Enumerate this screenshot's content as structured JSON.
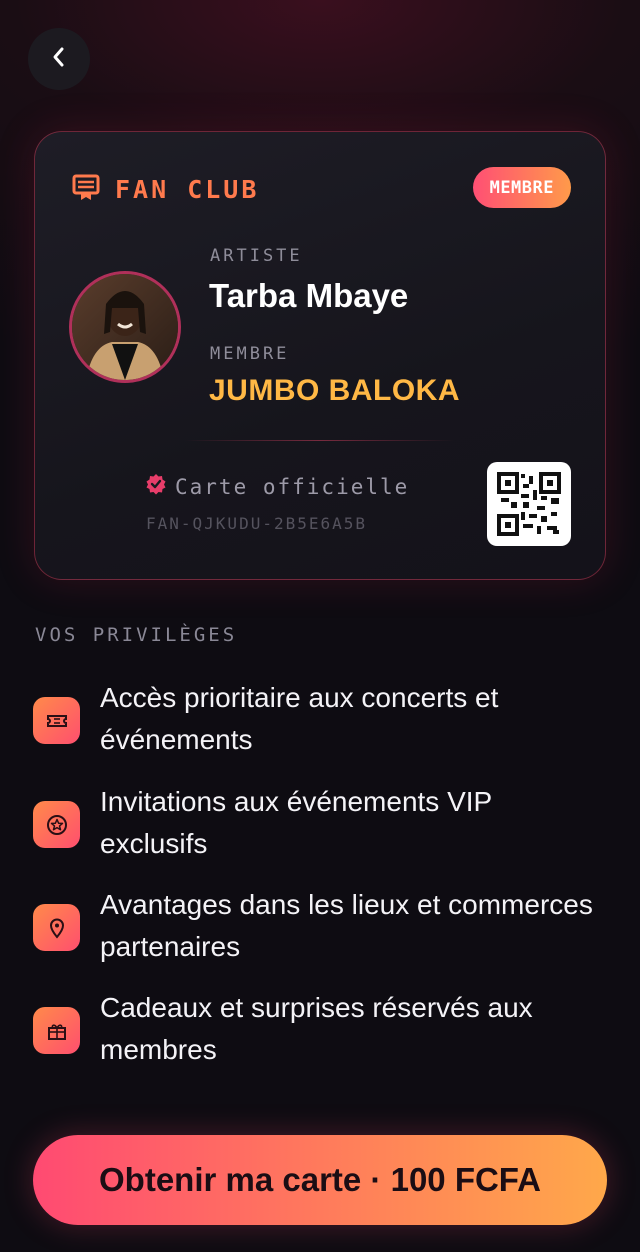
{
  "card": {
    "header_label": "FAN CLUB",
    "badge": "MEMBRE",
    "artist_label": "ARTISTE",
    "artist_name": "Tarba Mbaye",
    "member_label": "MEMBRE",
    "member_name": "JUMBO BALOKA",
    "official_text": "Carte officielle",
    "code": "FAN-QJKUDU-2B5E6A5B"
  },
  "privileges": {
    "title": "VOS PRIVILÈGES",
    "items": [
      {
        "icon": "ticket-icon",
        "text": "Accès prioritaire aux concerts et événements"
      },
      {
        "icon": "star-badge-icon",
        "text": "Invitations aux événements VIP exclusifs"
      },
      {
        "icon": "location-pin-icon",
        "text": "Avantages dans les lieux et commerces partenaires"
      },
      {
        "icon": "gift-icon",
        "text": "Cadeaux et surprises réservés aux membres"
      }
    ]
  },
  "cta": {
    "label": "Obtenir ma carte · 100 FCFA"
  },
  "colors": {
    "accent_orange": "#ff7a4d",
    "accent_gold": "#ffb845",
    "gradient_start": "#ff4a72",
    "gradient_end": "#ffa84a"
  }
}
